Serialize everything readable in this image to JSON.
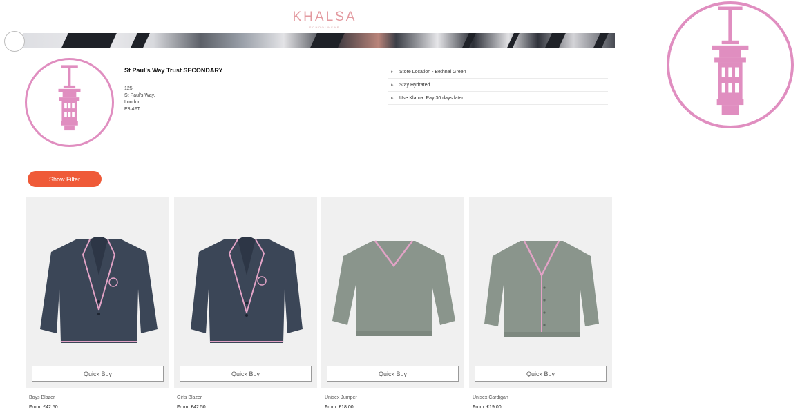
{
  "brand": {
    "name": "KHALSA",
    "tagline": "SCHOOLWEAR"
  },
  "school": {
    "name": "St Paul's Way Trust SECONDARY",
    "address": [
      "125",
      "St Paul's Way,",
      "London",
      "E3 4FT"
    ]
  },
  "store_info": [
    {
      "label": "Store Location - Bethnal Green",
      "icon": "chevron-right-icon"
    },
    {
      "label": "Stay Hydrated",
      "icon": "chevron-right-icon"
    },
    {
      "label": "Use Klarna. Pay 30 days later",
      "icon": "chevron-right-icon"
    }
  ],
  "filter_button": "Show Filter",
  "products": [
    {
      "name": "Boys Blazer",
      "price": "From: £42.50",
      "quick_buy": "Quick Buy",
      "type": "blazer",
      "color": "#3b4657"
    },
    {
      "name": "Girls Blazer",
      "price": "From: £42.50",
      "quick_buy": "Quick Buy",
      "type": "blazer",
      "color": "#3b4657"
    },
    {
      "name": "Unisex Jumper",
      "price": "From: £18.00",
      "quick_buy": "Quick Buy",
      "type": "jumper",
      "color": "#8a958c"
    },
    {
      "name": "Unisex Cardigan",
      "price": "From: £19.00",
      "quick_buy": "Quick Buy",
      "type": "cardigan",
      "color": "#8a958c"
    }
  ],
  "colors": {
    "accent": "#ef5a38",
    "crest": "#e08ec0",
    "logo": "#e39aa0",
    "trim": "#e2a3c6"
  }
}
